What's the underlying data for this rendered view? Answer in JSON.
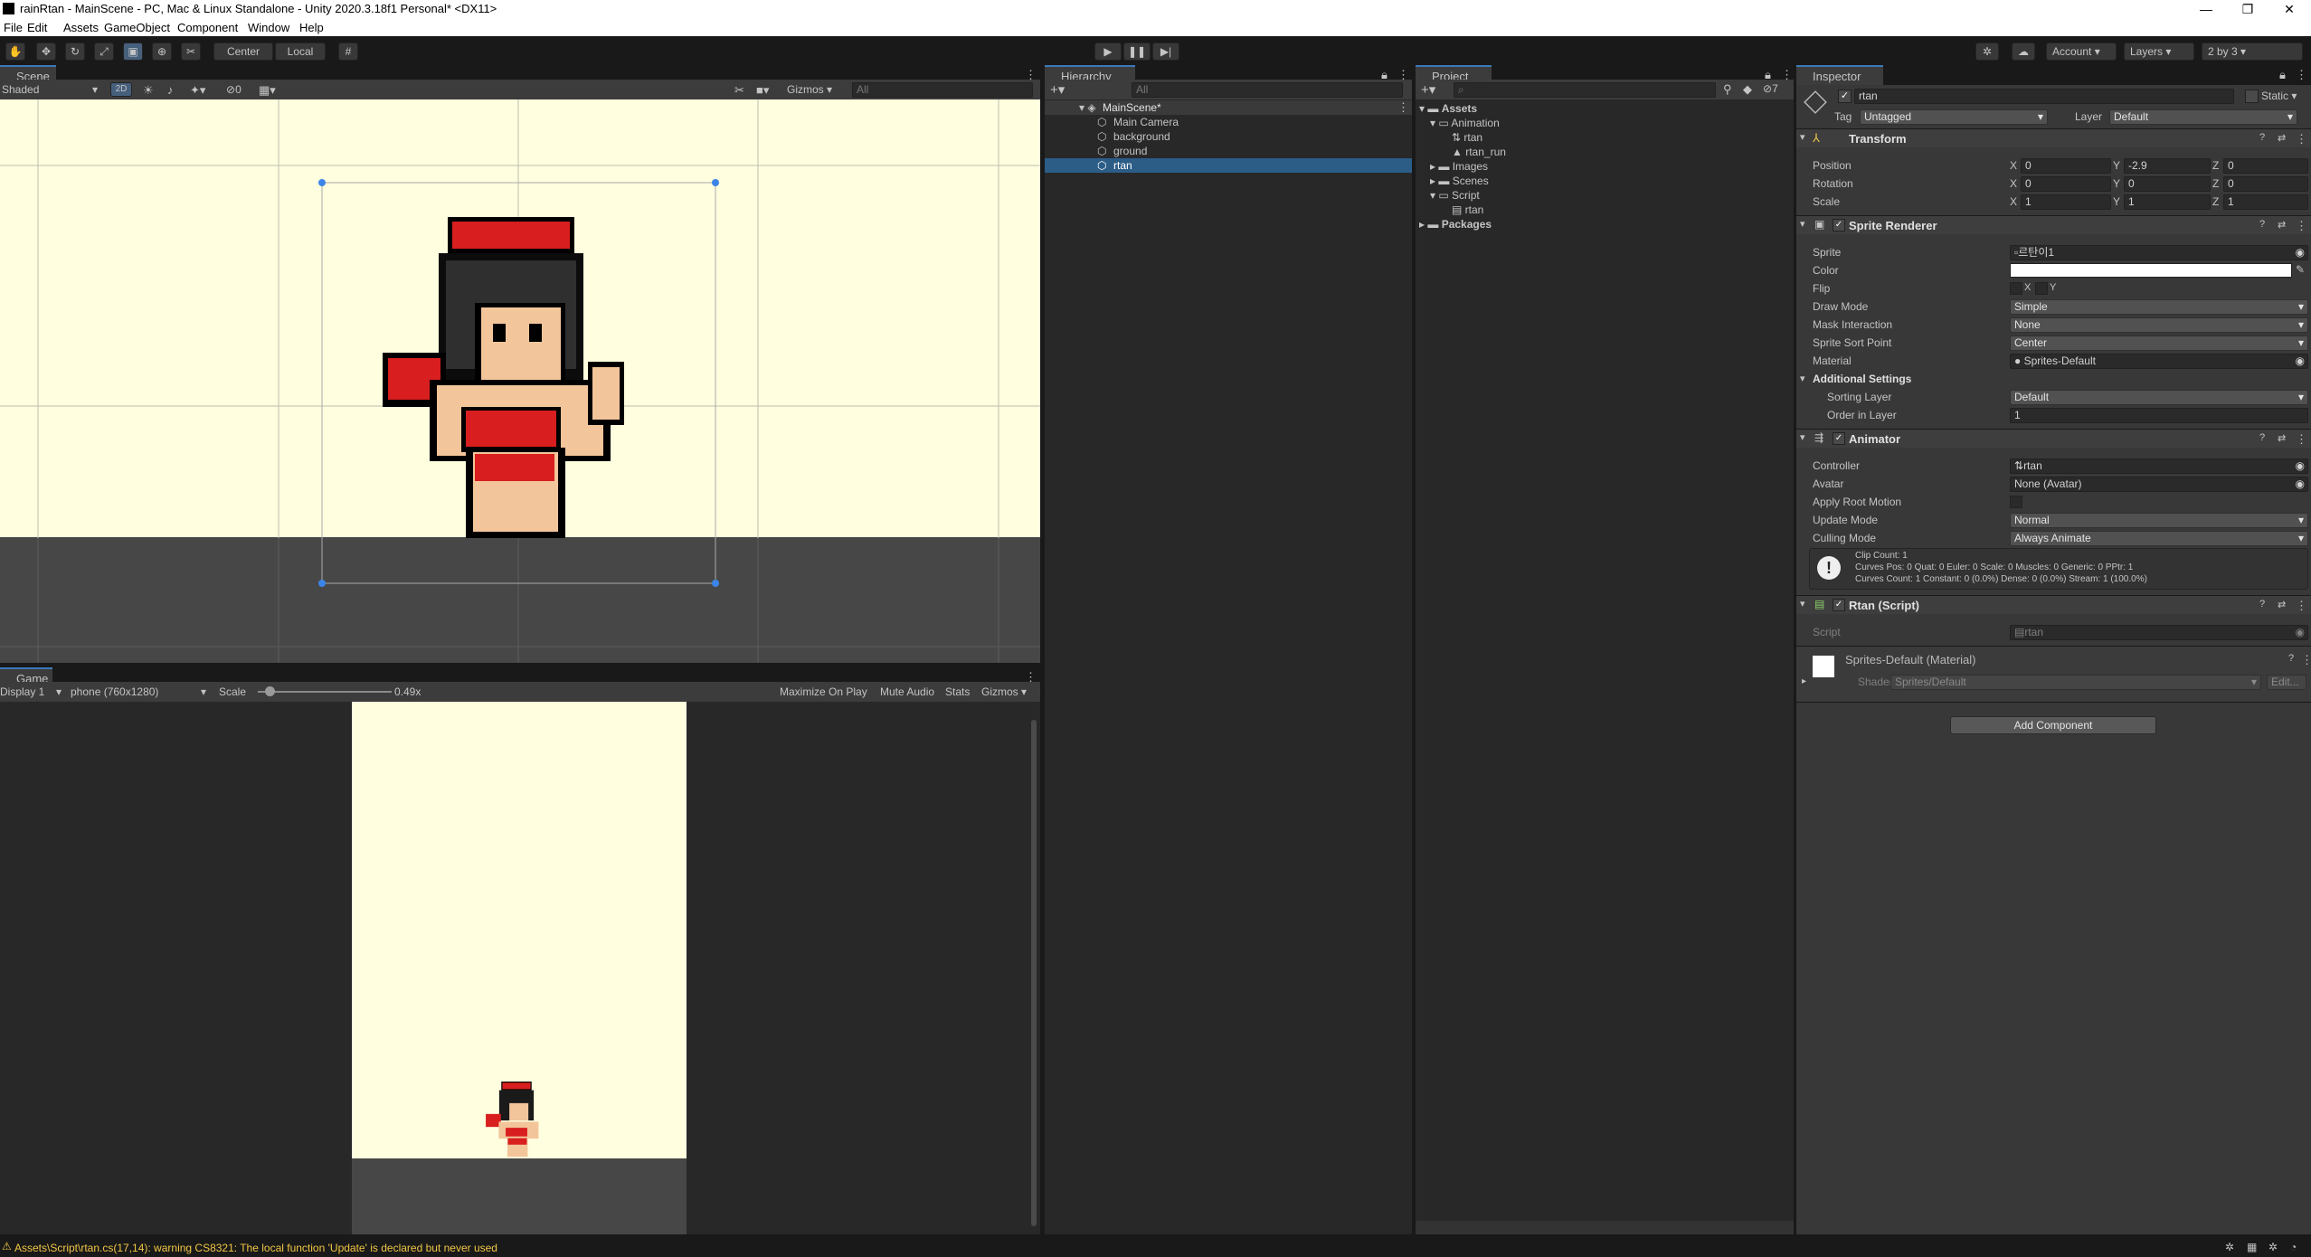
{
  "window": {
    "title": "rainRtan - MainScene - PC, Mac & Linux Standalone - Unity 2020.3.18f1 Personal* <DX11>",
    "controls": [
      "—",
      "❐",
      "✕"
    ]
  },
  "menu": [
    "File",
    "Edit",
    "Assets",
    "GameObject",
    "Component",
    "Window",
    "Help"
  ],
  "toolbar": {
    "pivot": "Center",
    "space": "Local",
    "account": "Account",
    "layers": "Layers",
    "layout": "2 by 3"
  },
  "scene": {
    "tab": "Scene",
    "shading": "Shaded",
    "mode2d": "2D",
    "hidden_count": "0",
    "gizmos": "Gizmos",
    "search_placeholder": "All"
  },
  "game": {
    "tab": "Game",
    "display": "Display 1",
    "resolution": "phone (760x1280)",
    "scale_label": "Scale",
    "scale_value": "0.49x",
    "scale_fraction": 0.09,
    "maximize": "Maximize On Play",
    "mute": "Mute Audio",
    "stats": "Stats",
    "gizmos": "Gizmos"
  },
  "hierarchy": {
    "tab": "Hierarchy",
    "search_placeholder": "All",
    "scene": "MainScene*",
    "items": [
      "Main Camera",
      "background",
      "ground",
      "rtan"
    ],
    "selected": "rtan"
  },
  "project": {
    "tab": "Project",
    "hidden_count": "7",
    "tree": {
      "assets": "Assets",
      "animation": "Animation",
      "anim_items": [
        "rtan",
        "rtan_run"
      ],
      "images": "Images",
      "scenes": "Scenes",
      "script": "Script",
      "script_items": [
        "rtan"
      ],
      "packages": "Packages"
    }
  },
  "inspector": {
    "tab": "Inspector",
    "object_name": "rtan",
    "static": "Static",
    "tag_label": "Tag",
    "tag": "Untagged",
    "layer_label": "Layer",
    "layer": "Default",
    "transform": {
      "title": "Transform",
      "position_label": "Position",
      "rotation_label": "Rotation",
      "scale_label": "Scale",
      "position": [
        "0",
        "-2.9",
        "0"
      ],
      "rotation": [
        "0",
        "0",
        "0"
      ],
      "scale": [
        "1",
        "1",
        "1"
      ],
      "axes": [
        "X",
        "Y",
        "Z"
      ]
    },
    "sprite_renderer": {
      "title": "Sprite Renderer",
      "labels": [
        "Sprite",
        "Color",
        "Flip",
        "Draw Mode",
        "Mask Interaction",
        "Sprite Sort Point",
        "Material"
      ],
      "sprite": "르탄이1",
      "flip_x": "X",
      "flip_y": "Y",
      "draw_mode": "Simple",
      "mask_interaction": "None",
      "sort_point": "Center",
      "material": "Sprites-Default",
      "additional": "Additional Settings",
      "sorting_layer_label": "Sorting Layer",
      "sorting_layer": "Default",
      "order_label": "Order in Layer",
      "order": "1"
    },
    "animator": {
      "title": "Animator",
      "labels": [
        "Controller",
        "Avatar",
        "Apply Root Motion",
        "Update Mode",
        "Culling Mode"
      ],
      "controller": "rtan",
      "avatar": "None (Avatar)",
      "update_mode": "Normal",
      "culling_mode": "Always Animate",
      "info": [
        "Clip Count: 1",
        "Curves Pos: 0 Quat: 0 Euler: 0 Scale: 0 Muscles: 0 Generic: 0 PPtr: 1",
        "Curves Count: 1 Constant: 0 (0.0%) Dense: 0 (0.0%) Stream: 1 (100.0%)"
      ]
    },
    "script": {
      "title": "Rtan (Script)",
      "label": "Script",
      "value": "rtan"
    },
    "material": {
      "title": "Sprites-Default (Material)",
      "shader_label": "Shader",
      "shader": "Sprites/Default",
      "edit": "Edit..."
    },
    "add_component": "Add Component"
  },
  "status": {
    "message": "Assets\\Script\\rtan.cs(17,14): warning CS8321: The local function 'Update' is declared but never used"
  },
  "colors": {
    "accent": "#3a79bb",
    "selection": "#2c5d87",
    "scene_bg": "#fffedf",
    "warning": "#f2c744"
  }
}
